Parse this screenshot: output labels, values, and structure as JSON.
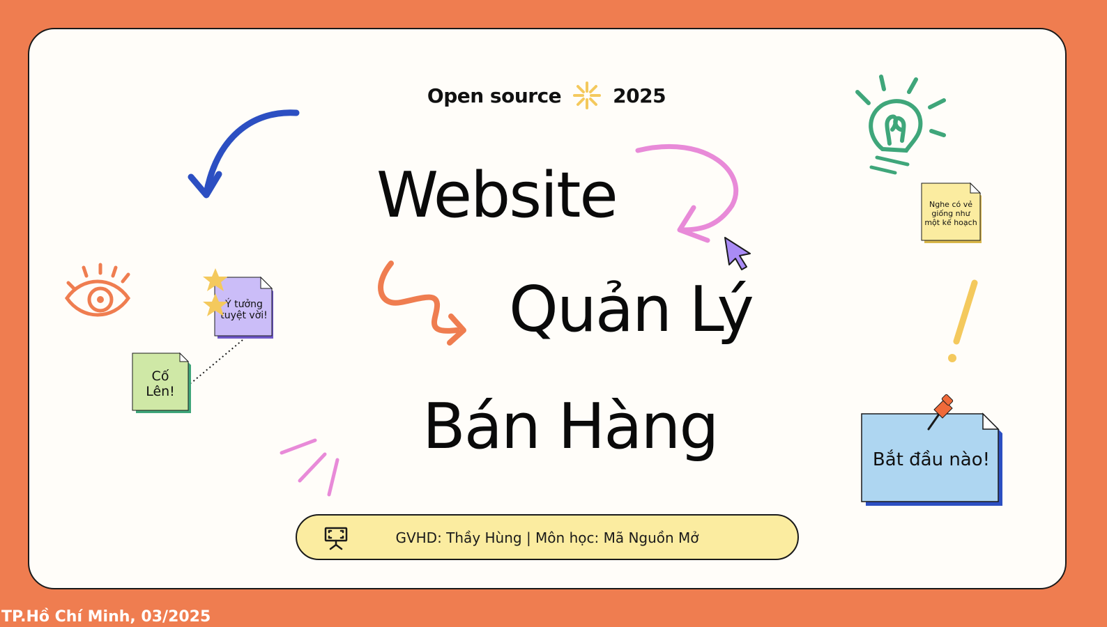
{
  "header": {
    "left": "Open source",
    "right": "2025"
  },
  "title": {
    "line1": "Website",
    "line2": "Quản Lý",
    "line3": "Bán Hàng"
  },
  "info": {
    "text": "GVHD: Thầy Hùng | Môn học: Mã Nguồn Mở"
  },
  "notes": {
    "idea": "Ý tưởng tuyệt vời!",
    "cheer": "Cố Lên!",
    "plan": "Nghe có vẻ giống như một kế hoạch",
    "start": "Bắt đầu nào!"
  },
  "footer": {
    "text": "TP.Hồ Chí Minh, 03/2025"
  },
  "colors": {
    "background": "#ef7d50",
    "card": "#fffdf9",
    "pill": "#fbeca0",
    "blue_arrow": "#2c4fc2",
    "pink": "#e88ad8",
    "orange": "#ef7d50",
    "green": "#3fa67a",
    "yellow": "#f4c95d",
    "purple_cursor": "#a98bf5"
  }
}
